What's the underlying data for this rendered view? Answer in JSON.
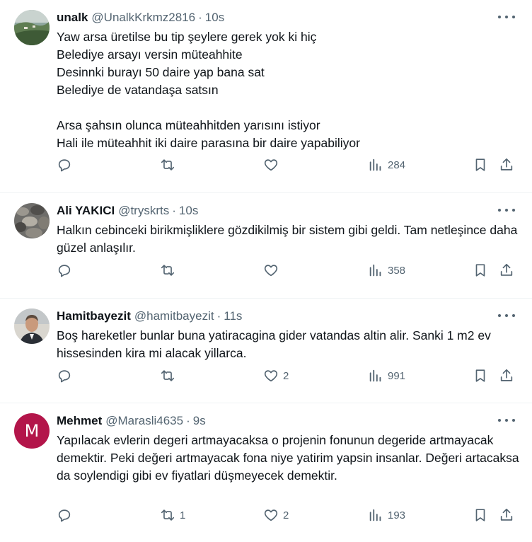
{
  "tweets": [
    {
      "name": "unalk",
      "handle": "@UnalkKrkmz2816",
      "dot": "·",
      "time": "10s",
      "text": "Yaw arsa üretilse bu tip şeylere gerek yok ki hiç\nBelediye arsayı versin müteahhite\nDesinnki burayı 50 daire yap bana sat\nBelediye de vatandaşa satsın\n\nArsa şahsın olunca müteahhitden yarısını istiyor\nHali ile müteahhit iki daire parasına bir daire yapabiliyor",
      "replies": "",
      "retweets": "",
      "likes": "",
      "views": "284"
    },
    {
      "name": "Ali YAKICI",
      "handle": "@tryskrts",
      "dot": "·",
      "time": "10s",
      "text": "Halkın cebinceki birikmişliklere gözdikilmiş bir sistem gibi geldi. Tam netleşince daha güzel anlaşılır.",
      "replies": "",
      "retweets": "",
      "likes": "",
      "views": "358"
    },
    {
      "name": "Hamitbayezit",
      "handle": "@hamitbayezit",
      "dot": "·",
      "time": "11s",
      "text": "Boş hareketler  bunlar buna yatiracagina gider vatandas altin alir.  Sanki 1 m2  ev hissesinden kira mi alacak yillarca.",
      "replies": "",
      "retweets": "",
      "likes": "2",
      "views": "991"
    },
    {
      "name": "Mehmet",
      "handle": "@Marasli4635",
      "dot": "·",
      "time": "9s",
      "avatar_letter": "M",
      "text": "Yapılacak evlerin degeri artmayacaksa o projenin fonunun degeride artmayacak demektir. Peki değeri artmayacak fona niye yatirim yapsin insanlar. Değeri artacaksa da soylendigi gibi ev fiyatlari düşmeyecek demektir.",
      "replies": "",
      "retweets": "1",
      "likes": "2",
      "views": "193"
    }
  ],
  "icons": {
    "reply": "reply-icon",
    "retweet": "retweet-icon",
    "like": "heart-icon",
    "views": "views-chart-icon",
    "bookmark": "bookmark-icon",
    "share": "share-icon",
    "more": "more-dots-icon"
  },
  "colors": {
    "text": "#0f1419",
    "secondary": "#536471",
    "divider": "#eff3f4",
    "mehmet_avatar": "#b3154a"
  }
}
